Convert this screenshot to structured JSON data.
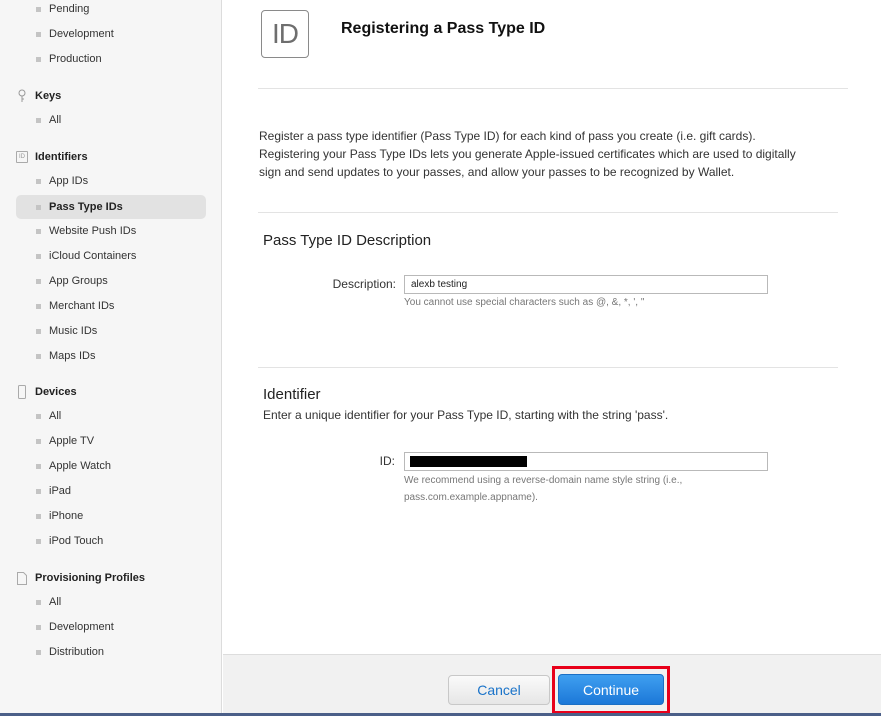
{
  "sidebar": {
    "certificates_sub": [
      {
        "label": "Pending"
      },
      {
        "label": "Development"
      },
      {
        "label": "Production"
      }
    ],
    "keys": {
      "label": "Keys",
      "icon": "key-icon",
      "items": [
        {
          "label": "All"
        }
      ]
    },
    "identifiers": {
      "label": "Identifiers",
      "icon": "id-icon",
      "icon_text": "ID",
      "items": [
        {
          "label": "App IDs"
        },
        {
          "label": "Pass Type IDs",
          "active": true
        },
        {
          "label": "Website Push IDs"
        },
        {
          "label": "iCloud Containers"
        },
        {
          "label": "App Groups"
        },
        {
          "label": "Merchant IDs"
        },
        {
          "label": "Music IDs"
        },
        {
          "label": "Maps IDs"
        }
      ]
    },
    "devices": {
      "label": "Devices",
      "icon": "device-icon",
      "items": [
        {
          "label": "All"
        },
        {
          "label": "Apple TV"
        },
        {
          "label": "Apple Watch"
        },
        {
          "label": "iPad"
        },
        {
          "label": "iPhone"
        },
        {
          "label": "iPod Touch"
        }
      ]
    },
    "profiles": {
      "label": "Provisioning Profiles",
      "icon": "document-icon",
      "items": [
        {
          "label": "All"
        },
        {
          "label": "Development"
        },
        {
          "label": "Distribution"
        }
      ]
    }
  },
  "main": {
    "badge_text": "ID",
    "title": "Registering a Pass Type ID",
    "intro_line1": "Register a pass type identifier (Pass Type ID) for each kind of pass you create (i.e. gift cards).",
    "intro_line2": "Registering your Pass Type IDs lets you generate Apple-issued certificates which are used to digitally",
    "intro_line3": "sign and send updates to your passes, and allow your passes to be recognized by Wallet.",
    "description_section": {
      "title": "Pass Type ID Description",
      "label": "Description:",
      "value": "alexb testing",
      "hint": "You cannot use special characters such as @, &, *, ', \""
    },
    "identifier_section": {
      "title": "Identifier",
      "description": "Enter a unique identifier for your Pass Type ID, starting with the string 'pass'.",
      "label": "ID:",
      "value": "",
      "hint_line1": "We recommend using a reverse-domain name style string (i.e.,",
      "hint_line2": "pass.com.example.appname)."
    }
  },
  "footer": {
    "cancel_label": "Cancel",
    "continue_label": "Continue"
  },
  "colors": {
    "accent": "#1c78d8",
    "highlight": "#e8001a",
    "sidebar_bg": "#f6f6f6"
  }
}
